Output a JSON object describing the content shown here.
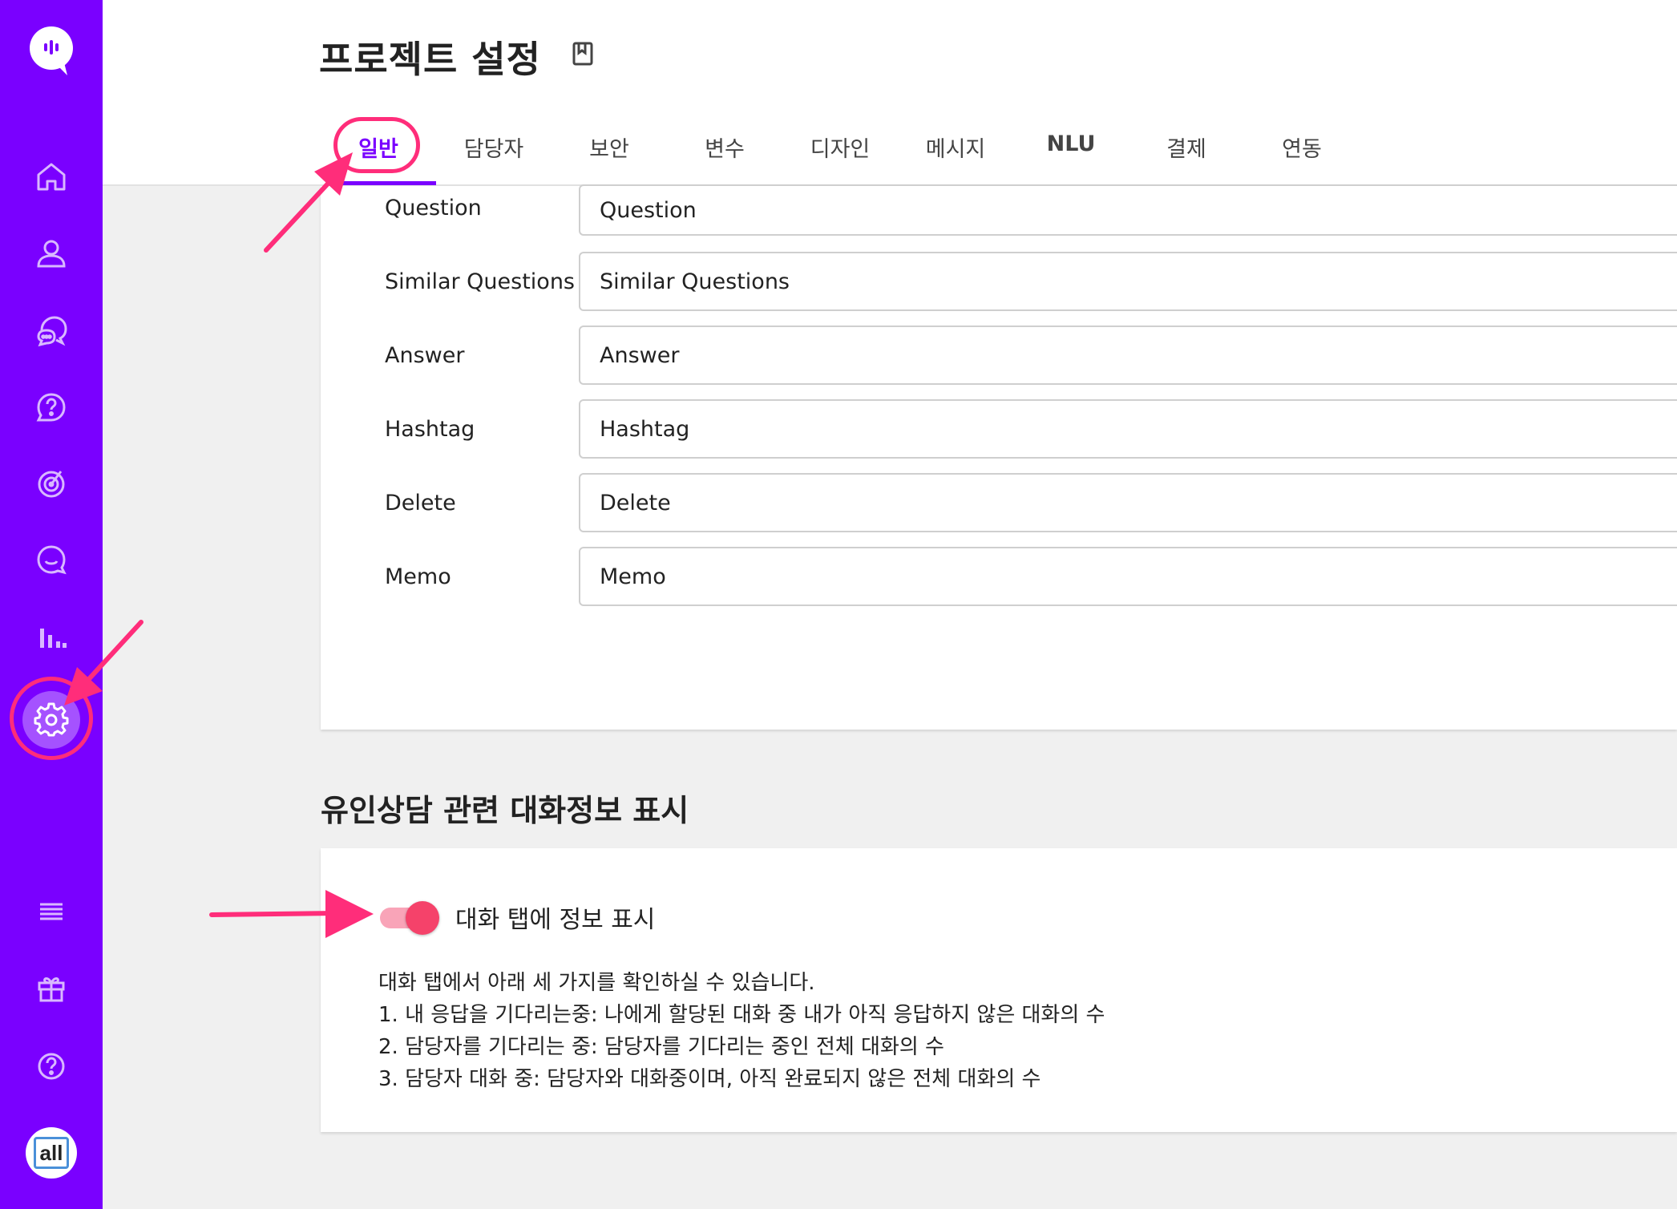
{
  "sidebar": {
    "items": [
      {
        "name": "home",
        "icon": "home-icon"
      },
      {
        "name": "user",
        "icon": "user-icon"
      },
      {
        "name": "chat",
        "icon": "chat-bubbles-icon"
      },
      {
        "name": "faq",
        "icon": "question-bubble-icon"
      },
      {
        "name": "target",
        "icon": "target-icon"
      },
      {
        "name": "smile",
        "icon": "smile-bubble-icon"
      },
      {
        "name": "stats",
        "icon": "bar-chart-icon"
      },
      {
        "name": "settings",
        "icon": "gear-icon",
        "active": true
      },
      {
        "name": "menu",
        "icon": "menu-icon"
      },
      {
        "name": "gift",
        "icon": "gift-icon"
      },
      {
        "name": "help",
        "icon": "help-circle-icon"
      }
    ],
    "avatar_text": "all",
    "accent": "#7a00ff"
  },
  "header": {
    "title": "프로젝트 설정",
    "tabs": [
      "일반",
      "담당자",
      "보안",
      "변수",
      "디자인",
      "메시지",
      "NLU",
      "결제",
      "연동"
    ],
    "active_tab": "일반"
  },
  "fields": [
    {
      "label": "Question",
      "value": "Question"
    },
    {
      "label": "Similar Questions",
      "value": "Similar Questions"
    },
    {
      "label": "Answer",
      "value": "Answer"
    },
    {
      "label": "Hashtag",
      "value": "Hashtag"
    },
    {
      "label": "Delete",
      "value": "Delete"
    },
    {
      "label": "Memo",
      "value": "Memo"
    }
  ],
  "section": {
    "title": "유인상담 관련 대화정보 표시",
    "toggle_label": "대화 탭에 정보 표시",
    "toggle_on": true,
    "description": [
      "대화 탭에서 아래 세 가지를 확인하실 수 있습니다.",
      "1. 내 응답을 기다리는중: 나에게 할당된 대화 중 내가 아직 응답하지 않은 대화의 수",
      "2. 담당자를 기다리는 중: 담당자를 기다리는 중인 전체 대화의 수",
      "3. 담당자 대화 중: 담당자와 대화중이며, 아직 완료되지 않은 전체 대화의 수"
    ]
  },
  "annotation_color": "#ff2d7a"
}
